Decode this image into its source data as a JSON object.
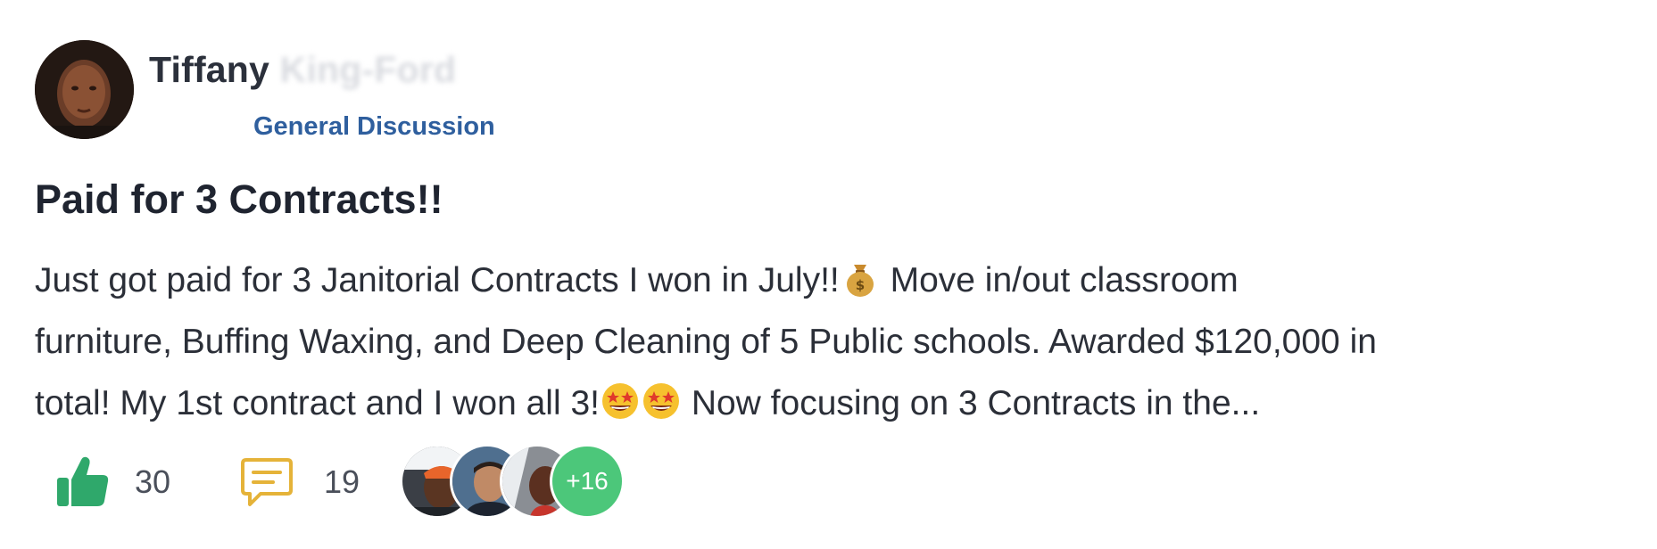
{
  "author": {
    "first_name": "Tiffany",
    "last_name_obscured": "King-Ford",
    "category": "General Discussion"
  },
  "post": {
    "title": "Paid for 3 Contracts!!",
    "body_line_1_a": "Just got paid for 3 Janitorial Contracts I won in July!!",
    "body_line_1_b": " Move in/out classroom",
    "body_line_2": "furniture, Buffing Waxing, and Deep Cleaning of 5 Public schools. Awarded $120,000 in",
    "body_line_3_a": "total! My 1st contract and I won all 3!",
    "body_line_3_b": " Now focusing on 3 Contracts in the..."
  },
  "actions": {
    "likes": "30",
    "comments": "19",
    "more_participants": "+16"
  },
  "icons": {
    "like": "thumbs-up-icon",
    "comment": "comment-bubble-icon",
    "money_bag": "money-bag-emoji",
    "star_struck": "star-struck-emoji"
  },
  "colors": {
    "category": "#2f5f9e",
    "like_icon": "#2fa86b",
    "comment_icon": "#e5b339",
    "more_badge": "#4cc77a"
  }
}
